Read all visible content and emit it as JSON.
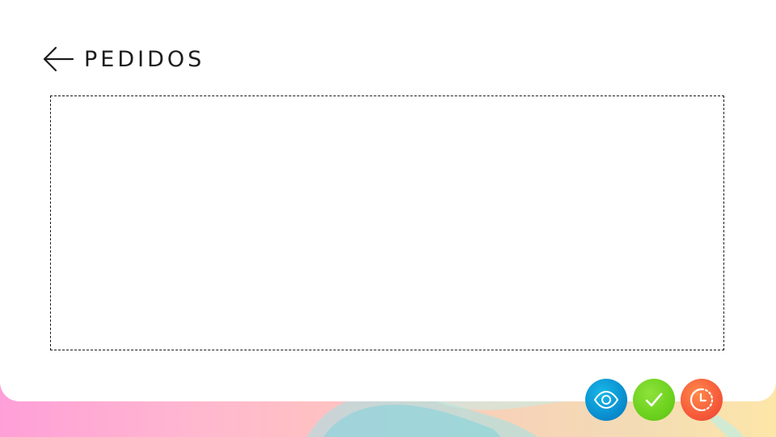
{
  "header": {
    "back_icon": "arrow-left-icon",
    "title": "PEDIDOS"
  },
  "content_area": {
    "border_style": "dashed",
    "border_color": "#1a1a1a"
  },
  "actions": [
    {
      "name": "view",
      "icon": "eye-icon",
      "color": "#0a8fd0"
    },
    {
      "name": "approve",
      "icon": "check-icon",
      "color": "#6cd11e"
    },
    {
      "name": "pending",
      "icon": "clock-history-icon",
      "color": "#f65a3a"
    }
  ],
  "colors": {
    "card": "#ffffff",
    "title": "#1c1c1c",
    "background_gradient": [
      "#ff9fd8",
      "#ffc3c0",
      "#f3dcb5",
      "#fde6a8"
    ]
  }
}
